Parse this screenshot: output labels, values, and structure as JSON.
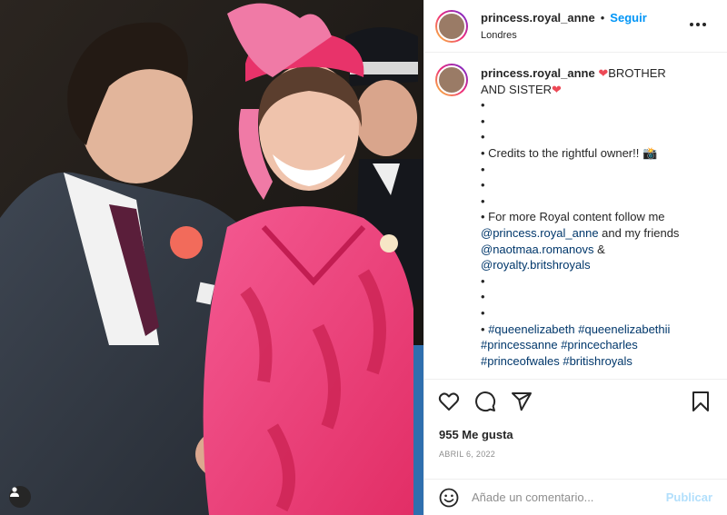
{
  "post": {
    "username": "princess.royal_anne",
    "separator": "•",
    "follow_label": "Seguir",
    "location": "Londres",
    "more_icon": "more-horizontal-icon"
  },
  "caption": {
    "username": "princess.royal_anne",
    "heart": "❤",
    "title": "BROTHER AND SISTER",
    "line_first": "BROTHER",
    "line_second": "AND SISTER",
    "bullet": "•",
    "credits": "• Credits to the rightful owner!! 📸",
    "more_content": "• For more Royal content follow me",
    "mention_1": "@princess.royal_anne",
    "and_friends": " and my friends",
    "mention_2": "@naotmaa.romanovs",
    "amp": " &",
    "mention_3": "@royalty.britshroyals",
    "hashtags_1a": "#queenelizabeth",
    "hashtags_1b": "#queenelizabethii",
    "hashtags_2a": "#princessanne",
    "hashtags_2b": "#princecharles",
    "hashtags_3a": "#princeofwales",
    "hashtags_3b": "#britishroyals"
  },
  "actions": {
    "like_icon": "heart-icon",
    "comment_icon": "comment-icon",
    "share_icon": "share-icon",
    "save_icon": "bookmark-icon"
  },
  "likes_text": "955 Me gusta",
  "date_text": "ABRIL 6, 2022",
  "add_comment": {
    "placeholder": "Añade un comentario...",
    "publish_label": "Publicar",
    "emoji_icon": "emoji-icon"
  },
  "colors": {
    "accent": "#0095f6",
    "publish_disabled": "#b2dffc",
    "heart": "#ed4956",
    "link": "#00376b",
    "coat_pink": "#f0407e"
  }
}
